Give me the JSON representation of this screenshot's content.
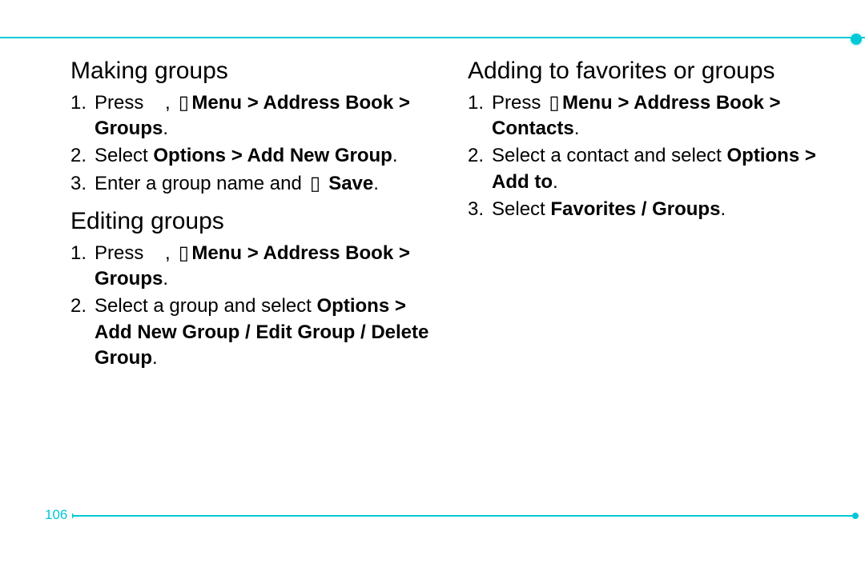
{
  "page_number": "106",
  "left_column": {
    "sections": [
      {
        "heading": "Making groups",
        "steps": [
          {
            "prefix": "Press ",
            "glyph1": " ",
            "mid": ", ",
            "glyph2": "▯",
            "bold": "Menu > Address Book > Groups",
            "suffix": "."
          },
          {
            "prefix": "Select ",
            "bold": "Options > Add New Group",
            "suffix": "."
          },
          {
            "prefix": "Enter a group name and ",
            "glyph2": "▯",
            "mid_space": "        ",
            "bold": "Save",
            "suffix": "."
          }
        ]
      },
      {
        "heading": "Editing groups",
        "steps": [
          {
            "prefix": "Press ",
            "glyph1": " ",
            "mid": ", ",
            "glyph2": "▯",
            "bold": "Menu > Address Book > Groups",
            "suffix": "."
          },
          {
            "prefix": "Select a group and select ",
            "bold": "Options > Add New Group / Edit Group / Delete Group",
            "suffix": "."
          }
        ]
      }
    ]
  },
  "right_column": {
    "sections": [
      {
        "heading": "Adding to favorites or groups",
        "steps": [
          {
            "prefix": "Press ",
            "glyph2": "▯",
            "bold": "Menu > Address Book > Contacts",
            "suffix": "."
          },
          {
            "prefix": "Select a contact and select ",
            "bold": "Options > Add to",
            "suffix": "."
          },
          {
            "prefix": "Select ",
            "bold": "Favorites / Groups",
            "suffix": "."
          }
        ]
      }
    ]
  }
}
